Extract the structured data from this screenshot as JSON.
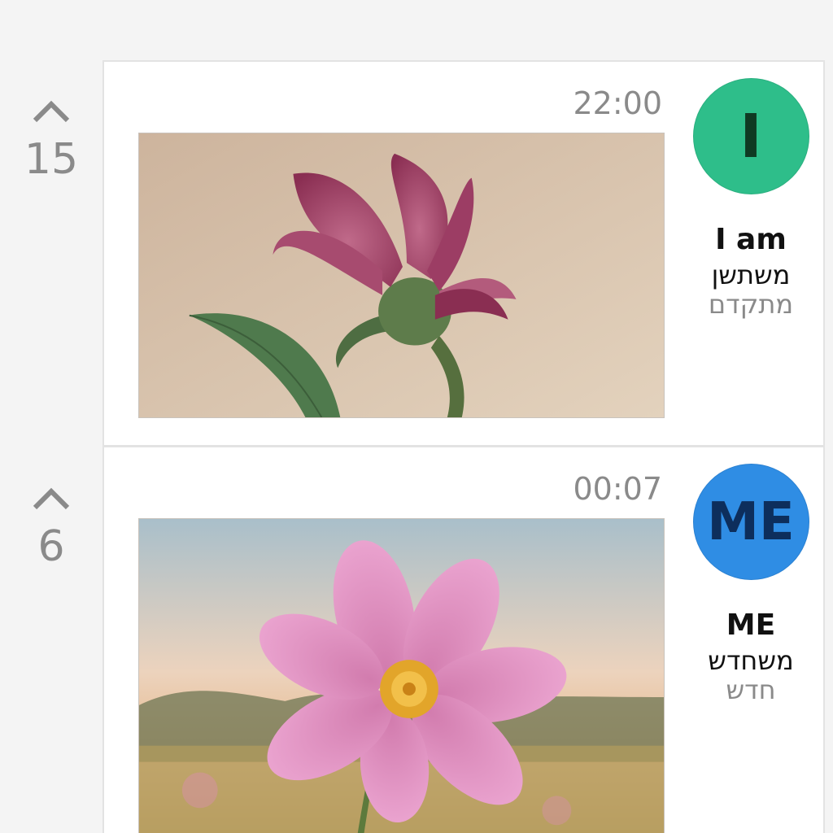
{
  "posts": [
    {
      "votes": "15",
      "time": "22:00",
      "author": {
        "avatar_text": "I",
        "avatar_color": "#2ebe8a",
        "avatar_text_color": "#0f3a23",
        "name": "I am",
        "rank": "משתשן",
        "level": "מתקדם"
      },
      "image": {
        "subject": "pink-lily-flower"
      }
    },
    {
      "votes": "6",
      "time": "00:07",
      "author": {
        "avatar_text": "ME",
        "avatar_color": "#2f8de4",
        "avatar_text_color": "#0d2e5c",
        "name": "ME",
        "rank": "משחדש",
        "level": "חדש"
      },
      "image": {
        "subject": "pink-cosmos-flower"
      }
    }
  ],
  "icons": {
    "upvote": "chevron-up-icon"
  },
  "colors": {
    "background": "#f4f4f4",
    "card": "#ffffff",
    "card_border": "#e3e3e3",
    "muted_text": "#8a8a8a"
  }
}
